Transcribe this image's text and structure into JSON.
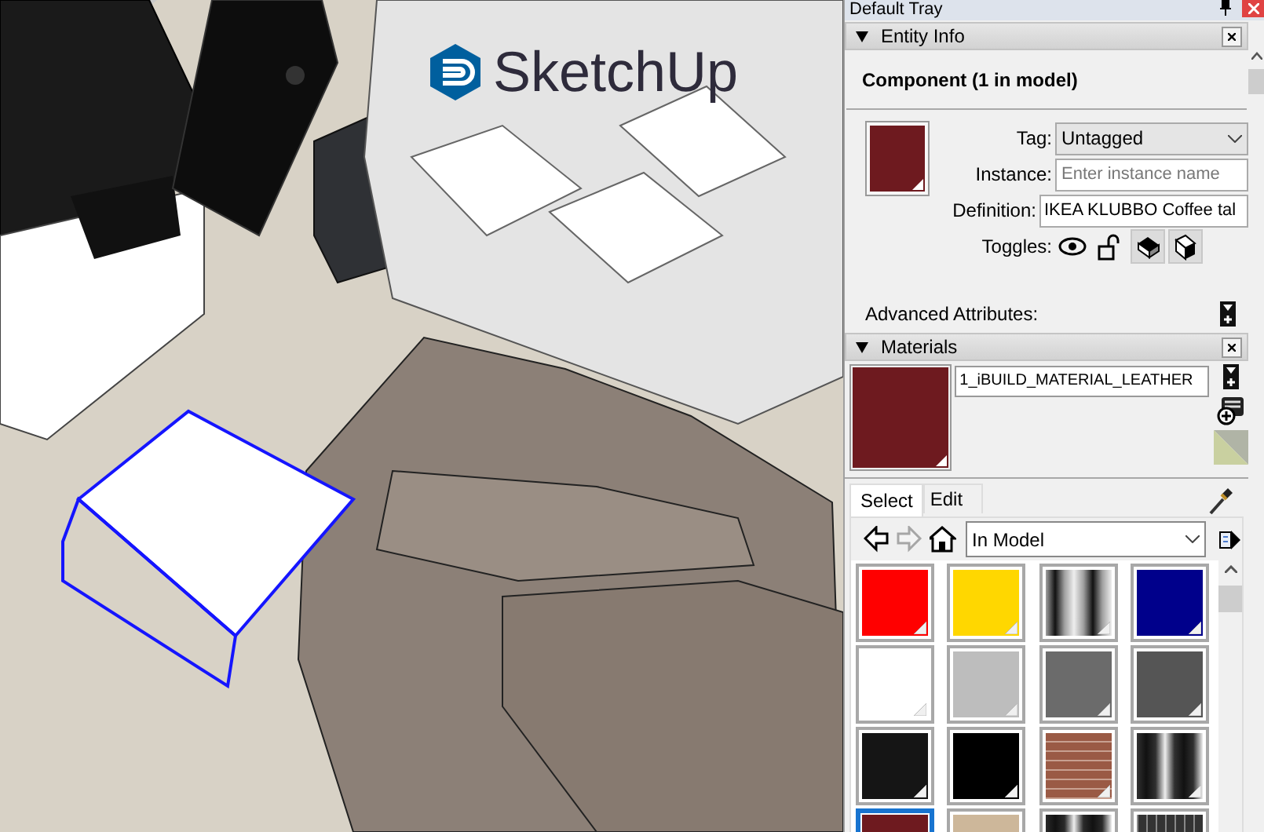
{
  "viewport": {
    "logo": "SketchUp"
  },
  "tray": {
    "title": "Default Tray",
    "entity_info": {
      "title": "Entity Info",
      "expanded": true,
      "heading": "Component (1 in model)",
      "tag": {
        "label": "Tag:",
        "value": "Untagged"
      },
      "instance": {
        "label": "Instance:",
        "placeholder": "Enter instance name"
      },
      "definition": {
        "label": "Definition:",
        "value": "IKEA KLUBBO Coffee tal"
      },
      "toggles": {
        "label": "Toggles:",
        "items": [
          {
            "kind": "hidden",
            "on": false
          },
          {
            "kind": "locked",
            "on": false
          },
          {
            "kind": "cast-shadows",
            "on": true
          },
          {
            "kind": "receive-shadows",
            "on": true
          }
        ]
      },
      "advanced": "Advanced Attributes:"
    },
    "materials": {
      "title": "Materials",
      "expanded": true,
      "name": "1_iBUILD_MATERIAL_LEATHER",
      "tabs": [
        {
          "label": "Select",
          "selected": true
        },
        {
          "label": "Edit",
          "selected": false
        }
      ],
      "nav": [
        {
          "kind": "back",
          "disabled": false
        },
        {
          "kind": "forward",
          "disabled": true
        },
        {
          "kind": "home",
          "disabled": false
        }
      ],
      "library": "In Model",
      "swatches": [
        {
          "kind": "solid",
          "color": "#ff0000",
          "selected": false
        },
        {
          "kind": "solid",
          "color": "#ffd700",
          "selected": false
        },
        {
          "kind": "stripes",
          "color": "#a0a0a0",
          "selected": false
        },
        {
          "kind": "solid",
          "color": "#00008b",
          "selected": false
        },
        {
          "kind": "solid",
          "color": "#ffffff",
          "selected": false
        },
        {
          "kind": "solid",
          "color": "#bdbdbd",
          "selected": false
        },
        {
          "kind": "solid",
          "color": "#6b6b6b",
          "selected": false
        },
        {
          "kind": "solid",
          "color": "#555555",
          "selected": false
        },
        {
          "kind": "solid",
          "color": "#151515",
          "selected": false
        },
        {
          "kind": "solid",
          "color": "#000000",
          "selected": false
        },
        {
          "kind": "brick",
          "color": "#9a5a45",
          "selected": false
        },
        {
          "kind": "stripes",
          "color": "#303030",
          "selected": false
        },
        {
          "kind": "solid",
          "color": "#6e1a1f",
          "selected": true
        },
        {
          "kind": "solid",
          "color": "#cdb79a",
          "selected": false
        },
        {
          "kind": "stripes",
          "color": "#2a2a2a",
          "selected": false
        },
        {
          "kind": "tiles",
          "color": "#333333",
          "selected": false
        }
      ]
    }
  }
}
